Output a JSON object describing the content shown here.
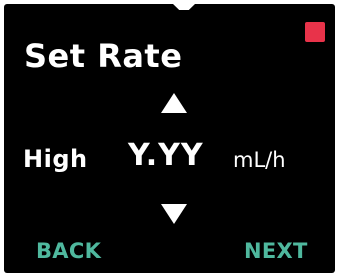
{
  "screen": {
    "title": "Set Rate",
    "indicator_color": "#e8334a"
  },
  "rate": {
    "level": "High",
    "value": "Y.YY",
    "unit": "mL/h",
    "increase_icon": "triangle-up-icon",
    "decrease_icon": "triangle-down-icon"
  },
  "softkeys": {
    "back_label": "BACK",
    "next_label": "NEXT",
    "color": "#4fb89e"
  }
}
